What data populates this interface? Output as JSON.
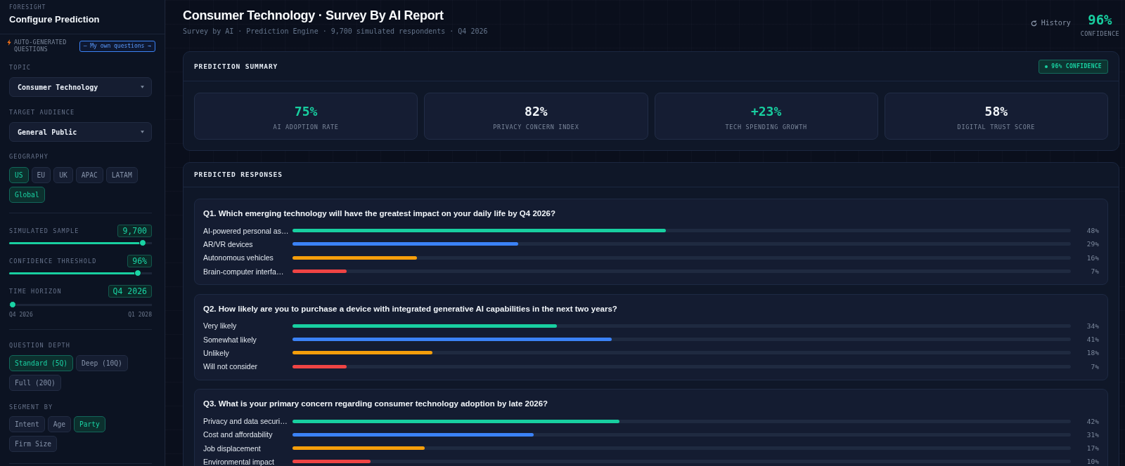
{
  "sidebar": {
    "eyebrow": "FORESIGHT",
    "title": "Configure Prediction",
    "mode": {
      "label": "AUTO-GENERATED QUESTIONS",
      "button": "— My own questions →"
    },
    "selects": [
      {
        "label": "TOPIC",
        "value": "Consumer Technology"
      },
      {
        "label": "TARGET AUDIENCE",
        "value": "General Public"
      }
    ],
    "geography": {
      "label": "GEOGRAPHY",
      "options": [
        {
          "label": "US",
          "selected": true
        },
        {
          "label": "EU",
          "selected": false
        },
        {
          "label": "UK",
          "selected": false
        },
        {
          "label": "APAC",
          "selected": false
        },
        {
          "label": "LATAM",
          "selected": false
        },
        {
          "label": "Global",
          "selected": true
        }
      ]
    },
    "sliders": [
      {
        "label": "SIMULATED SAMPLE",
        "value": "9,700",
        "level": 0.96
      },
      {
        "label": "CONFIDENCE THRESHOLD",
        "value": "96%",
        "level": 0.92
      },
      {
        "label": "TIME HORIZON",
        "value": "Q4 2026",
        "level": 0,
        "min_label": "Q4 2026",
        "max_label": "Q1 2028"
      }
    ],
    "depth": {
      "label": "QUESTION DEPTH",
      "options": [
        {
          "label": "Standard (5Q)",
          "selected": true
        },
        {
          "label": "Deep (10Q)",
          "selected": false
        },
        {
          "label": "Full (20Q)",
          "selected": false
        }
      ]
    },
    "segment": {
      "label": "SEGMENT BY",
      "options": [
        {
          "label": "Intent",
          "selected": false
        },
        {
          "label": "Age",
          "selected": false
        },
        {
          "label": "Party",
          "selected": true
        },
        {
          "label": "Firm Size",
          "selected": false
        }
      ]
    }
  },
  "header": {
    "title": "Consumer Technology · Survey By AI Report",
    "subtitle": "Survey by AI · Prediction Engine · 9,700 simulated respondents · Q4 2026",
    "history": "History",
    "confidence": {
      "value": "96%",
      "label": "CONFIDENCE"
    }
  },
  "summary": {
    "title": "PREDICTION SUMMARY",
    "badge": "96% CONFIDENCE",
    "stats": [
      {
        "value": "75%",
        "label": "AI ADOPTION RATE",
        "color": "#18cfa0"
      },
      {
        "value": "82%",
        "label": "PRIVACY CONCERN INDEX",
        "color": "#f1f5f9"
      },
      {
        "value": "+23%",
        "label": "TECH SPENDING GROWTH",
        "color": "#18cfa0"
      },
      {
        "value": "58%",
        "label": "DIGITAL TRUST SCORE",
        "color": "#f1f5f9"
      }
    ]
  },
  "responses": {
    "title": "PREDICTED RESPONSES",
    "questions": [
      {
        "text": "Q1. Which emerging technology will have the greatest impact on your daily life by Q4 2026?",
        "options": [
          {
            "label": "AI-powered personal as…",
            "level": 0.48,
            "percent": "48%",
            "color": "#18cfa0"
          },
          {
            "label": "AR/VR devices",
            "level": 0.29,
            "percent": "29%",
            "color": "#3b82f6"
          },
          {
            "label": "Autonomous vehicles",
            "level": 0.16,
            "percent": "16%",
            "color": "#f59e0b"
          },
          {
            "label": "Brain-computer interfa…",
            "level": 0.07,
            "percent": "7%",
            "color": "#ef4444"
          }
        ]
      },
      {
        "text": "Q2. How likely are you to purchase a device with integrated generative AI capabilities in the next two years?",
        "options": [
          {
            "label": "Very likely",
            "level": 0.34,
            "percent": "34%",
            "color": "#18cfa0"
          },
          {
            "label": "Somewhat likely",
            "level": 0.41,
            "percent": "41%",
            "color": "#3b82f6"
          },
          {
            "label": "Unlikely",
            "level": 0.18,
            "percent": "18%",
            "color": "#f59e0b"
          },
          {
            "label": "Will not consider",
            "level": 0.07,
            "percent": "7%",
            "color": "#ef4444"
          }
        ]
      },
      {
        "text": "Q3. What is your primary concern regarding consumer technology adoption by late 2026?",
        "options": [
          {
            "label": "Privacy and data securi…",
            "level": 0.42,
            "percent": "42%",
            "color": "#18cfa0"
          },
          {
            "label": "Cost and affordability",
            "level": 0.31,
            "percent": "31%",
            "color": "#3b82f6"
          },
          {
            "label": "Job displacement",
            "level": 0.17,
            "percent": "17%",
            "color": "#f59e0b"
          },
          {
            "label": "Environmental impact",
            "level": 0.1,
            "percent": "10%",
            "color": "#ef4444"
          }
        ]
      }
    ]
  }
}
